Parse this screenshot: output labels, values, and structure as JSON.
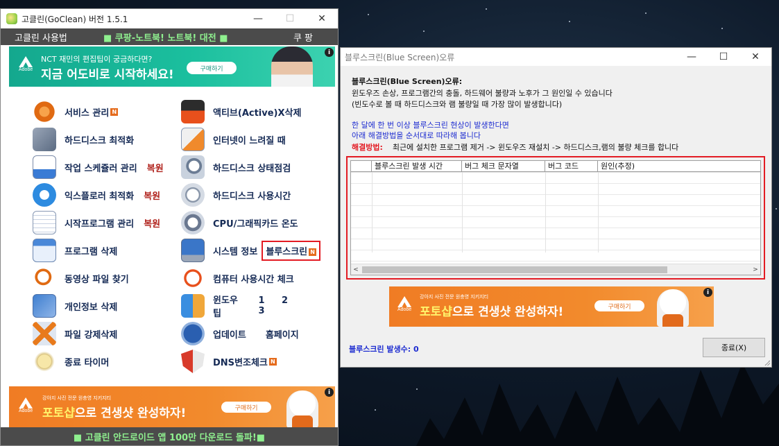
{
  "main_window": {
    "title": "고클린(GoClean) 버전 1.5.1",
    "controls": {
      "minimize": "—",
      "maximize": "☐",
      "close": "✕"
    },
    "menubar": {
      "usage": "고클린 사용법",
      "promo": "■ 쿠팡-노트북! 노트북! 대전 ■",
      "coupang": "쿠 팡"
    },
    "ad_top": {
      "brand": "Adobe",
      "subtitle": "NCT 재민의 편집팁이 궁금하다면?",
      "headline": "지금 어도비로 시작하세요!",
      "cta": "구매하기",
      "info": "i"
    },
    "menu": {
      "left": [
        {
          "label": "서비스 관리",
          "badge": "N"
        },
        {
          "label": "하드디스크 최적화"
        },
        {
          "label": "작업 스케쥴러 관리",
          "restore": "복원"
        },
        {
          "label": "익스플로러 최적화",
          "restore": "복원"
        },
        {
          "label": "시작프로그램 관리",
          "restore": "복원"
        },
        {
          "label": "프로그램 삭제"
        },
        {
          "label": "동영상 파일 찾기"
        },
        {
          "label": "개인정보 삭제"
        },
        {
          "label": "파일 강제삭제"
        },
        {
          "label": "종료 타이머"
        }
      ],
      "right": [
        {
          "label": "액티브(Active)X삭제"
        },
        {
          "label": "인터넷이 느려질 때"
        },
        {
          "label": "하드디스크 상태점검"
        },
        {
          "label": "하드디스크 사용시간"
        },
        {
          "label": "CPU/그래픽카드 온도"
        },
        {
          "label": "시스템 정보",
          "extra": "블루스크린",
          "badge": "N"
        },
        {
          "label": "컴퓨터 사용시간 체크"
        },
        {
          "label": "윈도우 팁",
          "links": [
            "1",
            "2",
            "3"
          ]
        },
        {
          "label": "업데이트",
          "extra": "홈페이지"
        },
        {
          "label": "DNS변조체크",
          "badge": "N"
        }
      ]
    },
    "ad_bottom": {
      "brand": "Adobe",
      "subtitle": "강아지 사진 전문 원충영 지키지티",
      "headline_hl": "포토샵",
      "headline_rest": "으로 견생샷 완성하자!",
      "cta": "구매하기",
      "info": "i"
    },
    "footer": "■ 고클린 안드로이드 앱 100만 다운로드 돌파!■"
  },
  "dialog": {
    "title": "블루스크린(Blue Screen)오류",
    "controls": {
      "minimize": "—",
      "maximize": "☐",
      "close": "✕"
    },
    "heading": "블루스크린(Blue Screen)오류:",
    "line1": "윈도우즈 손상, 프로그램간의 충돌, 하드웨어 불량과 노후가 그 원인일 수 있습니다",
    "line2": "(빈도수로 볼 때 하드디스크와 램 불량일 때 가장 많이 발생합니다)",
    "blue1": "한 달에 한 번 이상 블루스크린 현상이 발생한다면",
    "blue2": "아래 해결방법을 순서대로 따라해 봅니다",
    "solution_label": "해결방법:",
    "solution_text": "최근에 설치한 프로그램 제거 -> 윈도우즈 재설치 -> 하드디스크,램의 불량 체크를 합니다",
    "table": {
      "columns": [
        "",
        "블루스크린 발생 시간",
        "버그 체크 문자열",
        "버그 코드",
        "원인(추정)"
      ],
      "rows": []
    },
    "ad": {
      "brand": "Adobe",
      "subtitle": "강아지 사진 전문 원충영 지키지티",
      "headline_hl": "포토샵",
      "headline_rest": "으로 견생샷 완성하자!",
      "cta": "구매하기",
      "info": "i"
    },
    "count_label": "블루스크린 발생수: 0",
    "close_button": "종료(X)",
    "scroll_left": "<",
    "scroll_right": ">"
  }
}
